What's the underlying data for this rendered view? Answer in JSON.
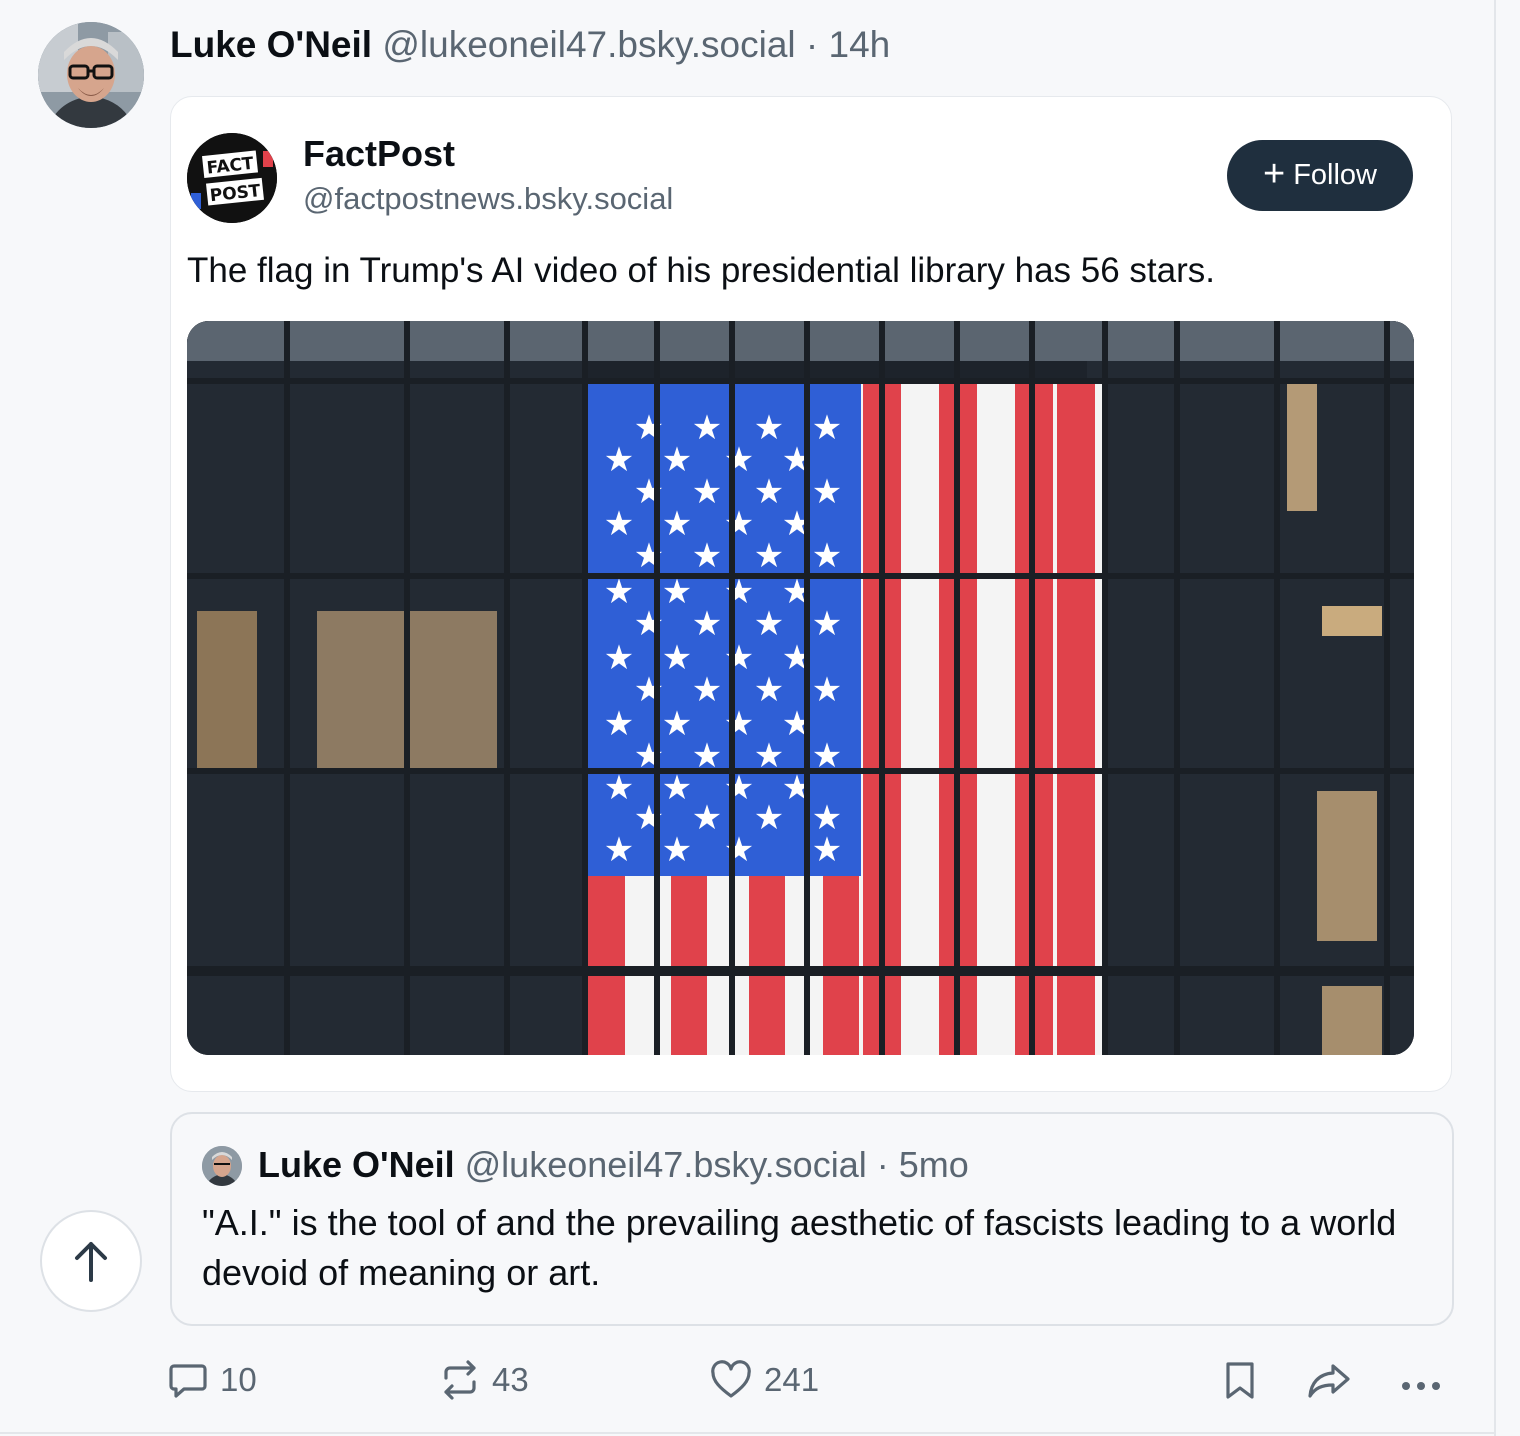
{
  "post": {
    "author_name": "Luke O'Neil",
    "author_handle": "@lukeoneil47.bsky.social",
    "separator": " · ",
    "age": "14h"
  },
  "embed": {
    "account_name": "FactPost",
    "account_handle": "@factpostnews.bsky.social",
    "logo_text_top": "FACT",
    "logo_text_bottom": "POST",
    "follow_label": "Follow",
    "text": "The flag in Trump's AI video of his presidential library has 56 stars."
  },
  "quote": {
    "author_name": "Luke O'Neil",
    "author_handle": "@lukeoneil47.bsky.social",
    "separator": " · ",
    "age": "5mo",
    "text": "\"A.I.\" is the tool of and the prevailing aesthetic of fascists leading to a world devoid of meaning or art."
  },
  "actions": {
    "replies": "10",
    "reposts": "43",
    "likes": "241"
  },
  "icons": {
    "reply": "speech-bubble-icon",
    "repost": "repost-arrows-icon",
    "like": "heart-icon",
    "bookmark": "bookmark-icon",
    "share": "share-arrow-icon",
    "more": "ellipsis-icon",
    "scroll_top": "arrow-up-icon"
  },
  "colors": {
    "follow_bg": "#1f2f3e",
    "meta_text": "#5a6672",
    "flag_red": "#e0424b",
    "flag_blue": "#2f5fd6"
  }
}
